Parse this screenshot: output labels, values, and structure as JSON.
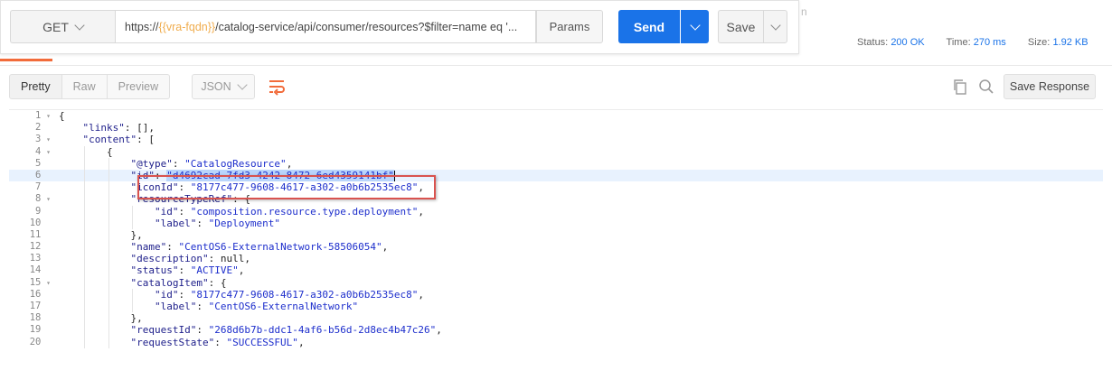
{
  "request": {
    "method": "GET",
    "url_prefix": "https://",
    "url_var": "{{vra-fqdn}}",
    "url_suffix": "/catalog-service/api/consumer/resources?$filter=name eq '...",
    "params_label": "Params",
    "send_label": "Send",
    "save_label": "Save"
  },
  "faint_text": "n",
  "response": {
    "status_label": "Status:",
    "status_value": "200 OK",
    "time_label": "Time:",
    "time_value": "270 ms",
    "size_label": "Size:",
    "size_value": "1.92 KB"
  },
  "toolbar": {
    "tabs": [
      "Pretty",
      "Raw",
      "Preview"
    ],
    "format": "JSON",
    "save_response_label": "Save Response"
  },
  "code_lines": [
    {
      "n": "1",
      "fold": true,
      "text": "{"
    },
    {
      "n": "2",
      "fold": false,
      "text": "    \"links\": [],"
    },
    {
      "n": "3",
      "fold": true,
      "text": "    \"content\": ["
    },
    {
      "n": "4",
      "fold": true,
      "text": "        {"
    },
    {
      "n": "5",
      "fold": false,
      "text": "            \"@type\": \"CatalogResource\","
    },
    {
      "n": "6",
      "fold": false,
      "text": "            \"id\": \"d4692cad-7fd3-4242-8472-6ed4359141bf\""
    },
    {
      "n": "7",
      "fold": false,
      "text": "            \"iconId\": \"8177c477-9608-4617-a302-a0b6b2535ec8\","
    },
    {
      "n": "8",
      "fold": true,
      "text": "            \"resourceTypeRef\": {"
    },
    {
      "n": "9",
      "fold": false,
      "text": "                \"id\": \"composition.resource.type.deployment\","
    },
    {
      "n": "10",
      "fold": false,
      "text": "                \"label\": \"Deployment\""
    },
    {
      "n": "11",
      "fold": false,
      "text": "            },"
    },
    {
      "n": "12",
      "fold": false,
      "text": "            \"name\": \"CentOS6-ExternalNetwork-58506054\","
    },
    {
      "n": "13",
      "fold": false,
      "text": "            \"description\": null,"
    },
    {
      "n": "14",
      "fold": false,
      "text": "            \"status\": \"ACTIVE\","
    },
    {
      "n": "15",
      "fold": true,
      "text": "            \"catalogItem\": {"
    },
    {
      "n": "16",
      "fold": false,
      "text": "                \"id\": \"8177c477-9608-4617-a302-a0b6b2535ec8\","
    },
    {
      "n": "17",
      "fold": false,
      "text": "                \"label\": \"CentOS6-ExternalNetwork\""
    },
    {
      "n": "18",
      "fold": false,
      "text": "            },"
    },
    {
      "n": "19",
      "fold": false,
      "text": "            \"requestId\": \"268d6b7b-ddc1-4af6-b56d-2d8ec4b47c26\","
    },
    {
      "n": "20",
      "fold": false,
      "text": "            \"requestState\": \"SUCCESSFUL\","
    }
  ],
  "highlight_line": 6,
  "colors": {
    "send": "#1a73e8",
    "var": "#f0ad4e",
    "accent_tab": "#f26b3a",
    "annotation": "#d9534f"
  }
}
